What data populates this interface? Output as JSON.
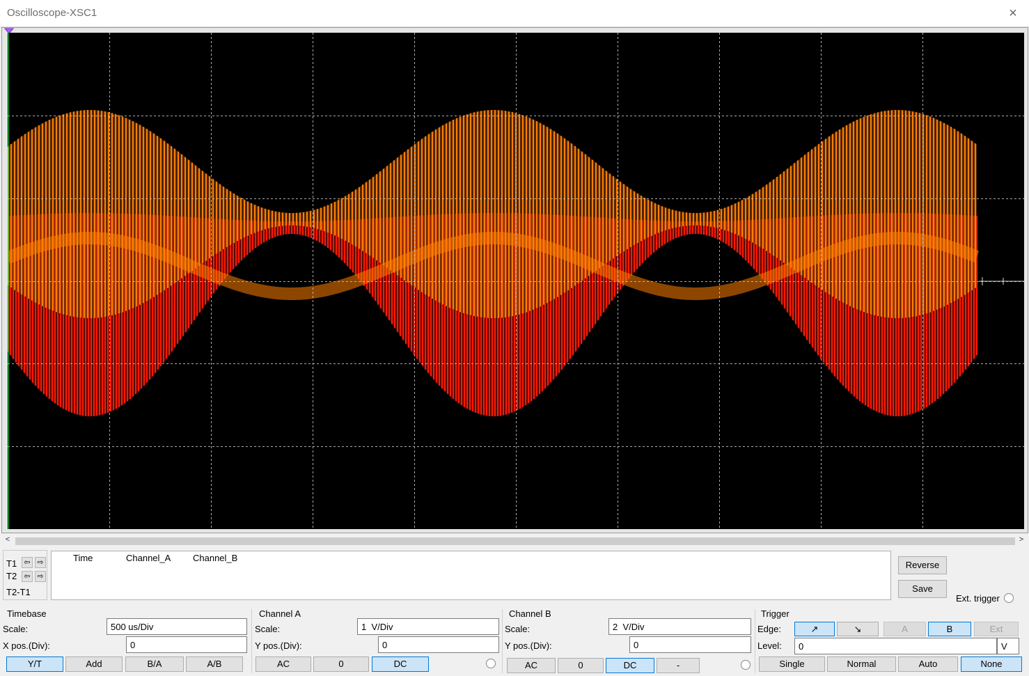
{
  "window": {
    "title": "Oscilloscope-XSC1"
  },
  "colors": {
    "screen_bg": "#000000",
    "grid": "#c8c8c8",
    "channel_a": "#ff8000",
    "channel_b": "#ff1a00",
    "active_button": "#cce4f7"
  },
  "icons": {
    "close": "×",
    "scroll_left": "<",
    "scroll_right": ">",
    "arrow_left": "⇦",
    "arrow_right": "⇨",
    "edge_rising": "↗",
    "edge_falling": "↘"
  },
  "cursors": {
    "t1_label": "T1",
    "t2_label": "T2",
    "diff_label": "T2-T1"
  },
  "readout": {
    "columns": [
      "Time",
      "Channel_A",
      "Channel_B"
    ]
  },
  "side_buttons": {
    "reverse": "Reverse",
    "save": "Save",
    "ext_trigger": "Ext. trigger"
  },
  "timebase": {
    "title": "Timebase",
    "scale_label": "Scale:",
    "scale_value": "500 us/Div",
    "xpos_label": "X pos.(Div):",
    "xpos_value": "0",
    "modes": [
      "Y/T",
      "Add",
      "B/A",
      "A/B"
    ],
    "active_mode": "Y/T"
  },
  "channel_a": {
    "title": "Channel A",
    "scale_label": "Scale:",
    "scale_value": "1  V/Div",
    "ypos_label": "Y pos.(Div):",
    "ypos_value": "0",
    "coupling": [
      "AC",
      "0",
      "DC"
    ],
    "active_coupling": "DC"
  },
  "channel_b": {
    "title": "Channel B",
    "scale_label": "Scale:",
    "scale_value": "2  V/Div",
    "ypos_label": "Y pos.(Div):",
    "ypos_value": "0",
    "coupling": [
      "AC",
      "0",
      "DC",
      "-"
    ],
    "active_coupling": "DC"
  },
  "trigger": {
    "title": "Trigger",
    "edge_label": "Edge:",
    "sources": [
      "A",
      "B",
      "Ext"
    ],
    "active_source": "B",
    "level_label": "Level:",
    "level_value": "0",
    "level_unit": "V",
    "modes": [
      "Single",
      "Normal",
      "Auto",
      "None"
    ],
    "active_mode": "None"
  }
}
